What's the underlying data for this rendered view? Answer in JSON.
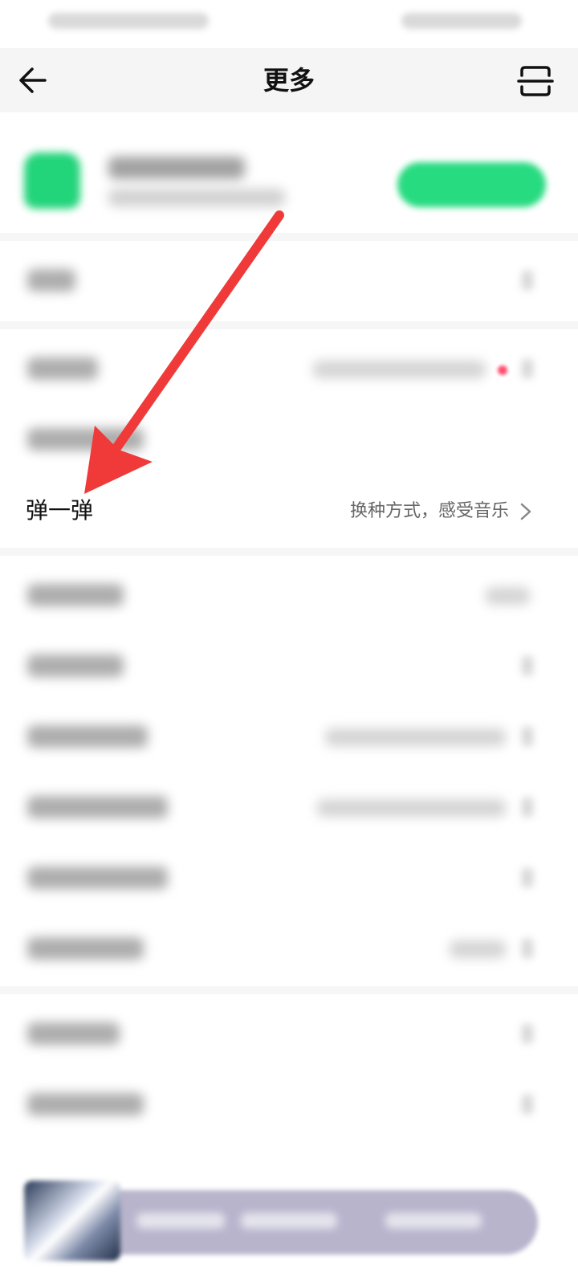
{
  "header": {
    "title": "更多",
    "back_icon": "arrow-left-icon",
    "scan_icon": "scan-icon"
  },
  "focused_item": {
    "label": "弹一弹",
    "value": "换种方式，感受音乐",
    "icon": "chevron-right-icon"
  },
  "colors": {
    "accent_green": "#27db80",
    "annotation_red": "#f03a3a",
    "badge_red": "#ff4d6d"
  }
}
